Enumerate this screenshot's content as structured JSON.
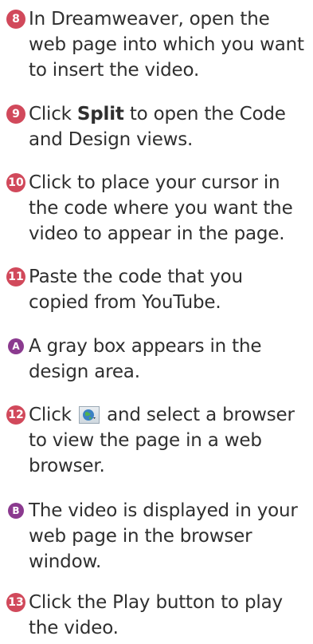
{
  "steps": [
    {
      "marker": "8",
      "kind": "number",
      "text": "In Dreamweaver, open the web page into which you want to insert the video."
    },
    {
      "marker": "9",
      "kind": "number",
      "text_before": "Click ",
      "bold": "Split",
      "text_after": " to open the Code and Design views."
    },
    {
      "marker": "10",
      "kind": "number",
      "text": "Click to place your cursor in the code where you want the video to appear in the page."
    },
    {
      "marker": "11",
      "kind": "number",
      "text": "Paste the code that you copied from YouTube."
    },
    {
      "marker": "A",
      "kind": "letter",
      "text": "A gray box appears in the design area."
    },
    {
      "marker": "12",
      "kind": "number",
      "text_before": "Click",
      "icon": "globe-icon",
      "text_after": "and select a browser to view the page in a web browser."
    },
    {
      "marker": "B",
      "kind": "letter",
      "text": "The video is displayed in your web page in the browser window."
    },
    {
      "marker": "13",
      "kind": "number",
      "text": "Click the Play button to play the video."
    }
  ],
  "colors": {
    "number_badge": "#d1495b",
    "letter_badge": "#8b3a8f",
    "text": "#2f2f2f"
  }
}
